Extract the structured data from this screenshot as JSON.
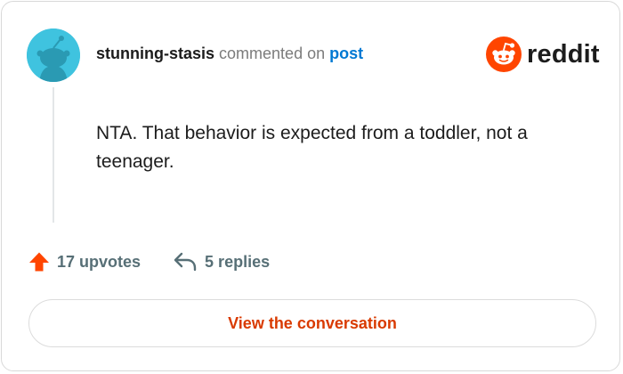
{
  "comment": {
    "username": "stunning-stasis",
    "action_text": "commented on",
    "target_link": "post",
    "body": "NTA. That behavior is expected from a toddler, not a teenager."
  },
  "brand": {
    "logo_text": "reddit",
    "logo_icon": "reddit-snoo-icon",
    "accent_color": "#ff4500"
  },
  "stats": {
    "upvotes_label": "17 upvotes",
    "upvote_icon": "upvote-arrow-icon",
    "replies_label": "5 replies",
    "reply_icon": "reply-arrow-icon"
  },
  "cta": {
    "label": "View the conversation"
  },
  "colors": {
    "avatar_bg": "#3fc3df",
    "username": "#1c1c1c",
    "muted": "#7c7c7c",
    "link": "#0079d3",
    "stat_text": "#576f76",
    "cta_text": "#d93a00"
  }
}
